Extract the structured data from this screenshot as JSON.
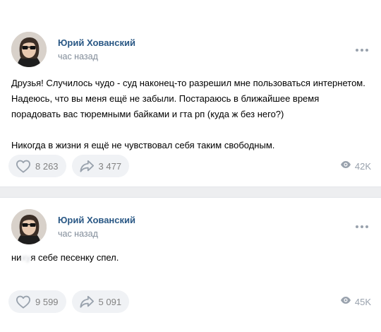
{
  "posts": [
    {
      "author": "Юрий Хованский",
      "time": "час назад",
      "paragraphs": [
        "Друзья! Случилось чудо - суд наконец-то разрешил мне пользоваться интернетом. Надеюсь, что вы меня ещё не забыли. Постараюсь в ближайшее время порадовать вас тюремными байками и гта рп (куда ж без него?)",
        "Никогда в жизни я ещё не чувствовал себя таким свободным."
      ],
      "likes": "8 263",
      "shares": "3 477",
      "views": "42K"
    },
    {
      "author": "Юрий Хованский",
      "time": "час назад",
      "text_start": "ни",
      "text_blurred": "ху",
      "text_end": "я себе песенку спел.",
      "likes": "9 599",
      "shares": "5 091",
      "views": "45K"
    }
  ],
  "icons": {
    "like": "heart-icon",
    "share": "share-arrow-icon",
    "views": "eye-icon",
    "more": "more-dots-icon"
  },
  "colors": {
    "author": "#2a5885",
    "secondary": "#818c99",
    "pill_bg": "#f0f2f5",
    "separator": "#edeef0"
  }
}
